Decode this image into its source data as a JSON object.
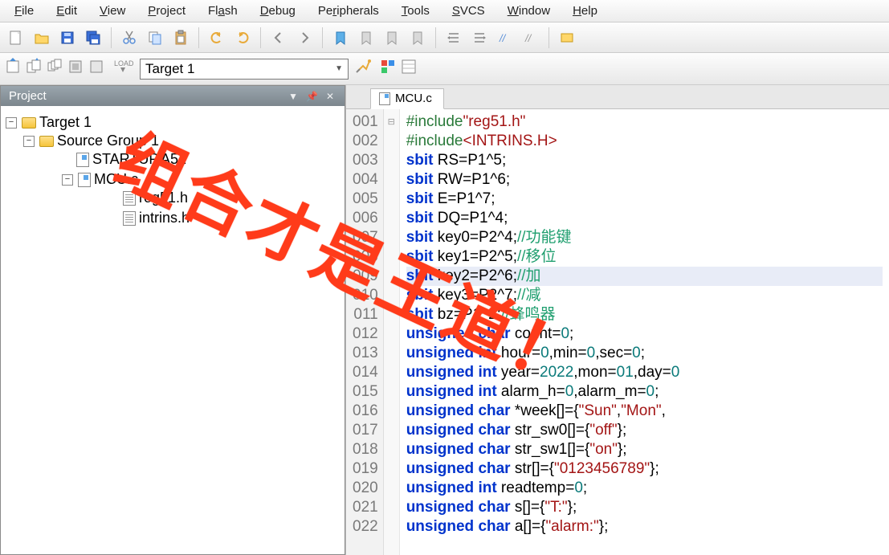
{
  "menu": [
    "File",
    "Edit",
    "View",
    "Project",
    "Flash",
    "Debug",
    "Peripherals",
    "Tools",
    "SVCS",
    "Window",
    "Help"
  ],
  "target_selector": "Target 1",
  "project_panel": {
    "title": "Project"
  },
  "tree": {
    "root": "Target 1",
    "group": "Source Group 1",
    "files": [
      "STARTUP.A51",
      "MCU.c"
    ],
    "headers": [
      "reg51.h",
      "intrins.h"
    ]
  },
  "tab": {
    "label": "MCU.c"
  },
  "code_lines": [
    {
      "n": "001",
      "html": "<span class='tok-pre'>#include</span><span class='tok-str'>\"reg51.h\"</span>"
    },
    {
      "n": "002",
      "html": "<span class='tok-pre'>#include</span><span class='tok-str'>&lt;INTRINS.H&gt;</span>"
    },
    {
      "n": "003",
      "html": "<span class='tok-kw'>sbit</span> RS=P1^5;"
    },
    {
      "n": "004",
      "html": "<span class='tok-kw'>sbit</span> RW=P1^6;"
    },
    {
      "n": "005",
      "html": "<span class='tok-kw'>sbit</span> E=P1^7;"
    },
    {
      "n": "006",
      "html": "<span class='tok-kw'>sbit</span> DQ=P1^4;"
    },
    {
      "n": "007",
      "html": "<span class='tok-kw'>sbit</span> key0=P2^4;<span class='tok-cmt'>//功能键</span>"
    },
    {
      "n": "008",
      "html": "<span class='tok-kw'>sbit</span> key1=P2^5;<span class='tok-cmt'>//移位</span>"
    },
    {
      "n": "009",
      "hl": true,
      "html": "<span class='tok-kw'>sbit</span> key2=P2^6;<span class='tok-cmt'>//加</span>"
    },
    {
      "n": "010",
      "html": "<span class='tok-kw'>sbit</span> key3=P2^7;<span class='tok-cmt'>//减</span>"
    },
    {
      "n": "011",
      "html": "<span class='tok-kw'>sbit</span> bz=P1^2;<span class='tok-cmt'>//蜂鸣器</span>"
    },
    {
      "n": "012",
      "html": "<span class='tok-kw'>unsigned</span> <span class='tok-kw'>char</span> count=<span class='tok-num'>0</span>;"
    },
    {
      "n": "013",
      "html": "<span class='tok-kw'>unsigned</span> <span class='tok-kw'>int</span> hour=<span class='tok-num'>0</span>,min=<span class='tok-num'>0</span>,sec=<span class='tok-num'>0</span>;"
    },
    {
      "n": "014",
      "html": "<span class='tok-kw'>unsigned</span> <span class='tok-kw'>int</span> year=<span class='tok-num'>2022</span>,mon=<span class='tok-num'>01</span>,day=<span class='tok-num'>0</span>"
    },
    {
      "n": "015",
      "html": "<span class='tok-kw'>unsigned</span> <span class='tok-kw'>int</span> alarm_h=<span class='tok-num'>0</span>,alarm_m=<span class='tok-num'>0</span>;"
    },
    {
      "n": "016",
      "html": "<span class='tok-kw'>unsigned</span> <span class='tok-kw'>char</span> *week[]={<span class='tok-str'>\"Sun\"</span>,<span class='tok-str'>\"Mon\"</span>,"
    },
    {
      "n": "017",
      "html": "<span class='tok-kw'>unsigned</span> <span class='tok-kw'>char</span> str_sw0[]={<span class='tok-str'>\"off\"</span>};"
    },
    {
      "n": "018",
      "html": "<span class='tok-kw'>unsigned</span> <span class='tok-kw'>char</span> str_sw1[]={<span class='tok-str'>\"on\"</span>};"
    },
    {
      "n": "019",
      "html": "<span class='tok-kw'>unsigned</span> <span class='tok-kw'>char</span> str[]={<span class='tok-str'>\"0123456789\"</span>};"
    },
    {
      "n": "020",
      "html": "<span class='tok-kw'>unsigned</span> <span class='tok-kw'>int</span> readtemp=<span class='tok-num'>0</span>;"
    },
    {
      "n": "021",
      "html": "<span class='tok-kw'>unsigned</span> <span class='tok-kw'>char</span> s[]={<span class='tok-str'>\"T:\"</span>};"
    },
    {
      "n": "022",
      "html": "<span class='tok-kw'>unsigned</span> <span class='tok-kw'>char</span> a[]={<span class='tok-str'>\"alarm:\"</span>};"
    }
  ],
  "watermark": "组合才是王道！"
}
